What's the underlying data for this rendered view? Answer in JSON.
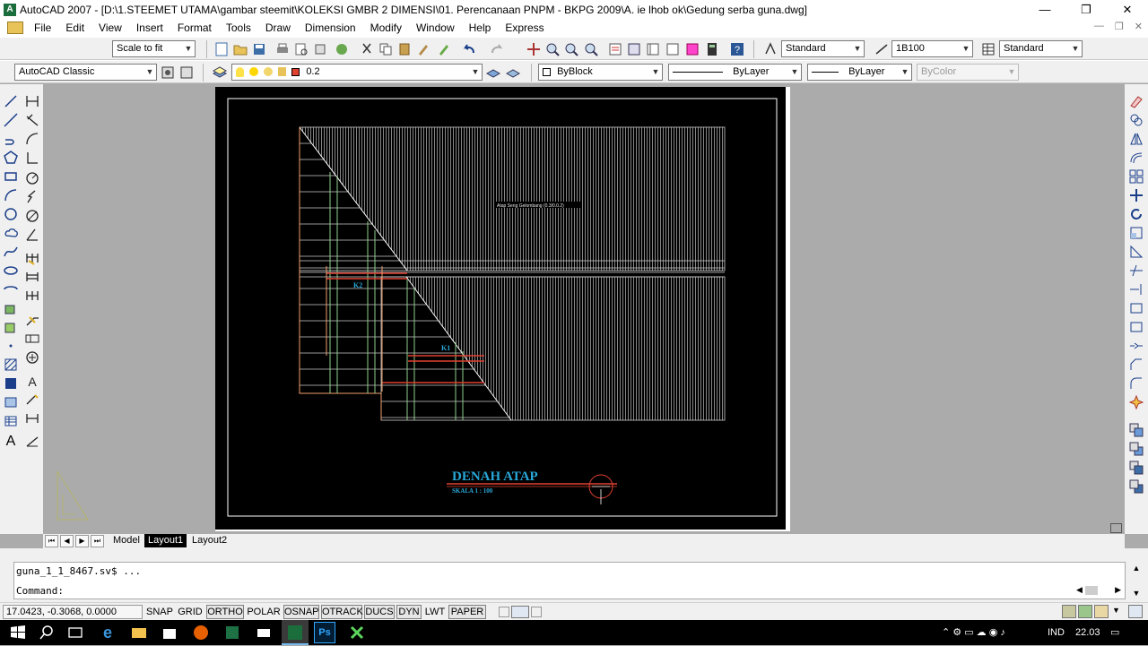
{
  "window": {
    "title": "AutoCAD 2007 - [D:\\1.STEEMET UTAMA\\gambar steemit\\KOLEKSI GMBR 2 DIMENSI\\01. Perencanaan PNPM - BKPG 2009\\A. ie lhob ok\\Gedung serba guna.dwg]",
    "minimize": "—",
    "restore": "❐",
    "close": "✕",
    "app_icon_letter": "A"
  },
  "menu": [
    "File",
    "Edit",
    "View",
    "Insert",
    "Format",
    "Tools",
    "Draw",
    "Dimension",
    "Modify",
    "Window",
    "Help",
    "Express"
  ],
  "doc_controls": {
    "minimize": "—",
    "restore": "❐",
    "close": "✕"
  },
  "toolbar1": {
    "scale": "Scale to fit",
    "text_style": "Standard",
    "dim_style": "1B100",
    "table_style": "Standard"
  },
  "toolbar2": {
    "workspace": "AutoCAD Classic",
    "layer": "0.2",
    "color": "ByBlock",
    "linetype": "ByLayer",
    "lineweight": "ByLayer",
    "plotstyle": "ByColor"
  },
  "drawing": {
    "title": "DENAH ATAP",
    "scale_label": "SKALA   1 : 100",
    "roof_note": "Atap Seng Gelombang (0.3/0.0.2)",
    "label_k2": "K2",
    "label_k1": "K1",
    "colors": {
      "title": "#29a8d8",
      "red": "#e04030",
      "orange": "#f0a070",
      "green": "#8fd08a",
      "hatch": "#bfbfbf"
    }
  },
  "tabs": {
    "nav": [
      "⏮",
      "◀",
      "▶",
      "⏭"
    ],
    "items": [
      {
        "label": "Model",
        "active": false
      },
      {
        "label": "Layout1",
        "active": true
      },
      {
        "label": "Layout2",
        "active": false
      }
    ]
  },
  "command": {
    "history": "guna_1_1_8467.sv$ ...",
    "prompt": "Command:"
  },
  "status": {
    "coords": "17.0423, -0.3068, 0.0000",
    "buttons": [
      {
        "label": "SNAP",
        "on": false
      },
      {
        "label": "GRID",
        "on": false
      },
      {
        "label": "ORTHO",
        "on": true
      },
      {
        "label": "POLAR",
        "on": false
      },
      {
        "label": "OSNAP",
        "on": true
      },
      {
        "label": "OTRACK",
        "on": true
      },
      {
        "label": "DUCS",
        "on": true
      },
      {
        "label": "DYN",
        "on": true
      },
      {
        "label": "LWT",
        "on": false
      },
      {
        "label": "PAPER",
        "on": true
      }
    ]
  },
  "taskbar": {
    "language": "IND",
    "time": "22.03",
    "ps_label": "Ps"
  }
}
